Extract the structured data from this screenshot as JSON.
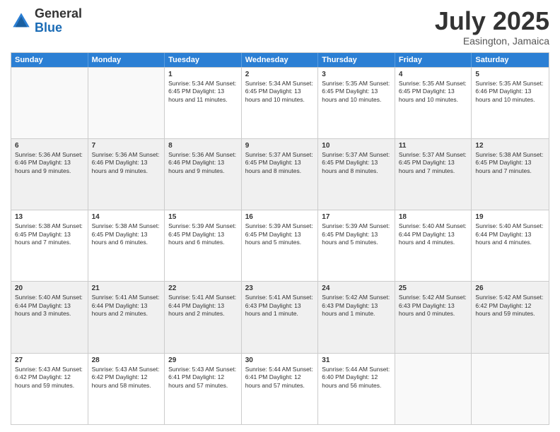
{
  "logo": {
    "general": "General",
    "blue": "Blue"
  },
  "title": {
    "month": "July 2025",
    "location": "Easington, Jamaica"
  },
  "header_days": [
    "Sunday",
    "Monday",
    "Tuesday",
    "Wednesday",
    "Thursday",
    "Friday",
    "Saturday"
  ],
  "rows": [
    [
      {
        "day": "",
        "text": "",
        "empty": true
      },
      {
        "day": "",
        "text": "",
        "empty": true
      },
      {
        "day": "1",
        "text": "Sunrise: 5:34 AM\nSunset: 6:45 PM\nDaylight: 13 hours and 11 minutes."
      },
      {
        "day": "2",
        "text": "Sunrise: 5:34 AM\nSunset: 6:45 PM\nDaylight: 13 hours and 10 minutes."
      },
      {
        "day": "3",
        "text": "Sunrise: 5:35 AM\nSunset: 6:45 PM\nDaylight: 13 hours and 10 minutes."
      },
      {
        "day": "4",
        "text": "Sunrise: 5:35 AM\nSunset: 6:45 PM\nDaylight: 13 hours and 10 minutes."
      },
      {
        "day": "5",
        "text": "Sunrise: 5:35 AM\nSunset: 6:46 PM\nDaylight: 13 hours and 10 minutes."
      }
    ],
    [
      {
        "day": "6",
        "text": "Sunrise: 5:36 AM\nSunset: 6:46 PM\nDaylight: 13 hours and 9 minutes.",
        "shaded": true
      },
      {
        "day": "7",
        "text": "Sunrise: 5:36 AM\nSunset: 6:46 PM\nDaylight: 13 hours and 9 minutes.",
        "shaded": true
      },
      {
        "day": "8",
        "text": "Sunrise: 5:36 AM\nSunset: 6:46 PM\nDaylight: 13 hours and 9 minutes.",
        "shaded": true
      },
      {
        "day": "9",
        "text": "Sunrise: 5:37 AM\nSunset: 6:45 PM\nDaylight: 13 hours and 8 minutes.",
        "shaded": true
      },
      {
        "day": "10",
        "text": "Sunrise: 5:37 AM\nSunset: 6:45 PM\nDaylight: 13 hours and 8 minutes.",
        "shaded": true
      },
      {
        "day": "11",
        "text": "Sunrise: 5:37 AM\nSunset: 6:45 PM\nDaylight: 13 hours and 7 minutes.",
        "shaded": true
      },
      {
        "day": "12",
        "text": "Sunrise: 5:38 AM\nSunset: 6:45 PM\nDaylight: 13 hours and 7 minutes.",
        "shaded": true
      }
    ],
    [
      {
        "day": "13",
        "text": "Sunrise: 5:38 AM\nSunset: 6:45 PM\nDaylight: 13 hours and 7 minutes."
      },
      {
        "day": "14",
        "text": "Sunrise: 5:38 AM\nSunset: 6:45 PM\nDaylight: 13 hours and 6 minutes."
      },
      {
        "day": "15",
        "text": "Sunrise: 5:39 AM\nSunset: 6:45 PM\nDaylight: 13 hours and 6 minutes."
      },
      {
        "day": "16",
        "text": "Sunrise: 5:39 AM\nSunset: 6:45 PM\nDaylight: 13 hours and 5 minutes."
      },
      {
        "day": "17",
        "text": "Sunrise: 5:39 AM\nSunset: 6:45 PM\nDaylight: 13 hours and 5 minutes."
      },
      {
        "day": "18",
        "text": "Sunrise: 5:40 AM\nSunset: 6:44 PM\nDaylight: 13 hours and 4 minutes."
      },
      {
        "day": "19",
        "text": "Sunrise: 5:40 AM\nSunset: 6:44 PM\nDaylight: 13 hours and 4 minutes."
      }
    ],
    [
      {
        "day": "20",
        "text": "Sunrise: 5:40 AM\nSunset: 6:44 PM\nDaylight: 13 hours and 3 minutes.",
        "shaded": true
      },
      {
        "day": "21",
        "text": "Sunrise: 5:41 AM\nSunset: 6:44 PM\nDaylight: 13 hours and 2 minutes.",
        "shaded": true
      },
      {
        "day": "22",
        "text": "Sunrise: 5:41 AM\nSunset: 6:44 PM\nDaylight: 13 hours and 2 minutes.",
        "shaded": true
      },
      {
        "day": "23",
        "text": "Sunrise: 5:41 AM\nSunset: 6:43 PM\nDaylight: 13 hours and 1 minute.",
        "shaded": true
      },
      {
        "day": "24",
        "text": "Sunrise: 5:42 AM\nSunset: 6:43 PM\nDaylight: 13 hours and 1 minute.",
        "shaded": true
      },
      {
        "day": "25",
        "text": "Sunrise: 5:42 AM\nSunset: 6:43 PM\nDaylight: 13 hours and 0 minutes.",
        "shaded": true
      },
      {
        "day": "26",
        "text": "Sunrise: 5:42 AM\nSunset: 6:42 PM\nDaylight: 12 hours and 59 minutes.",
        "shaded": true
      }
    ],
    [
      {
        "day": "27",
        "text": "Sunrise: 5:43 AM\nSunset: 6:42 PM\nDaylight: 12 hours and 59 minutes."
      },
      {
        "day": "28",
        "text": "Sunrise: 5:43 AM\nSunset: 6:42 PM\nDaylight: 12 hours and 58 minutes."
      },
      {
        "day": "29",
        "text": "Sunrise: 5:43 AM\nSunset: 6:41 PM\nDaylight: 12 hours and 57 minutes."
      },
      {
        "day": "30",
        "text": "Sunrise: 5:44 AM\nSunset: 6:41 PM\nDaylight: 12 hours and 57 minutes."
      },
      {
        "day": "31",
        "text": "Sunrise: 5:44 AM\nSunset: 6:40 PM\nDaylight: 12 hours and 56 minutes."
      },
      {
        "day": "",
        "text": "",
        "empty": true
      },
      {
        "day": "",
        "text": "",
        "empty": true
      }
    ]
  ]
}
